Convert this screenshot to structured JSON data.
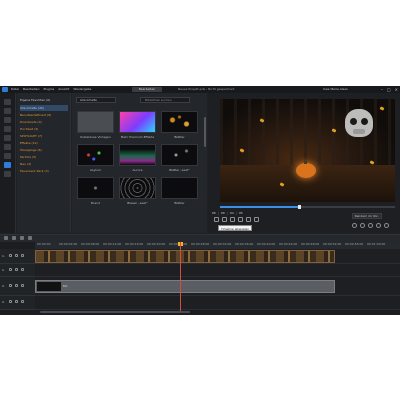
{
  "menubar": {
    "menu": [
      "Datei",
      "Bearbeiten",
      "Plugins",
      "Ansicht",
      "Wiedergabe"
    ],
    "center_button": "Bearbeiten",
    "title": "Neues Projekt.pds - Nicht gespeichert",
    "user": "Uwe Marie Alsen"
  },
  "library": {
    "header": "Eigene Favoriten (0)",
    "categories": [
      "Alle Inhalte (45)",
      "Benutzerdefiniert (6)",
      "Downloads (0)",
      "Hochzeit (3)",
      "SPOTLIGHT (7)",
      "Effekte (12)",
      "Übergänge (6)",
      "Particle (5)",
      "Neu (3)",
      "Feuerwerk Pack (3)"
    ],
    "selected_index": 0
  },
  "gallery": {
    "filter_label": "Alle Inhalte",
    "search_placeholder": "Bibliothek suchen",
    "tiles": [
      {
        "label": "Kostenlose Vorlagen",
        "style": "grey"
      },
      {
        "label": "Mehr Premium Effekte",
        "style": "gradient"
      },
      {
        "label": "Blätter",
        "style": "leaves"
      },
      {
        "label": "Asylum",
        "style": "dots"
      },
      {
        "label": "Aurora",
        "style": "aurora"
      },
      {
        "label": "Blätter „Leaf“",
        "style": "sparse"
      },
      {
        "label": "Brand",
        "style": "dark"
      },
      {
        "label": "Blasen „Leaf“",
        "style": "particles"
      },
      {
        "label": "Blätter",
        "style": "dark"
      }
    ]
  },
  "preview": {
    "timecode": "00 ; 00 ; 04 ; 05",
    "tooltip": "Timeline abspielen",
    "mode_label": "Rendern im Vor..",
    "progress_fraction": 0.45
  },
  "timeline": {
    "ruler_ticks": [
      "00:00:00",
      "00:00:04:00",
      "00:00:08:00",
      "00:00:12:00",
      "00:00:16:00",
      "00:00:20:00",
      "00:00:24:00",
      "00:00:28:00",
      "00:00:32:00",
      "00:00:36:00",
      "00:00:40:00",
      "00:00:44:00",
      "00:00:48:00",
      "00:00:52:00",
      "00:00:56:00",
      "00:01:00:00"
    ],
    "tracks": [
      {
        "number": "1.",
        "kind": "video"
      },
      {
        "number": "1.",
        "kind": "audio"
      },
      {
        "number": "2.",
        "kind": "video"
      },
      {
        "number": "2.",
        "kind": "audio"
      }
    ],
    "audio_clip_label": "Mo"
  },
  "colors": {
    "accent": "#2f7dd6",
    "category_text": "#e49a3a",
    "playhead": "#d94b3b"
  }
}
